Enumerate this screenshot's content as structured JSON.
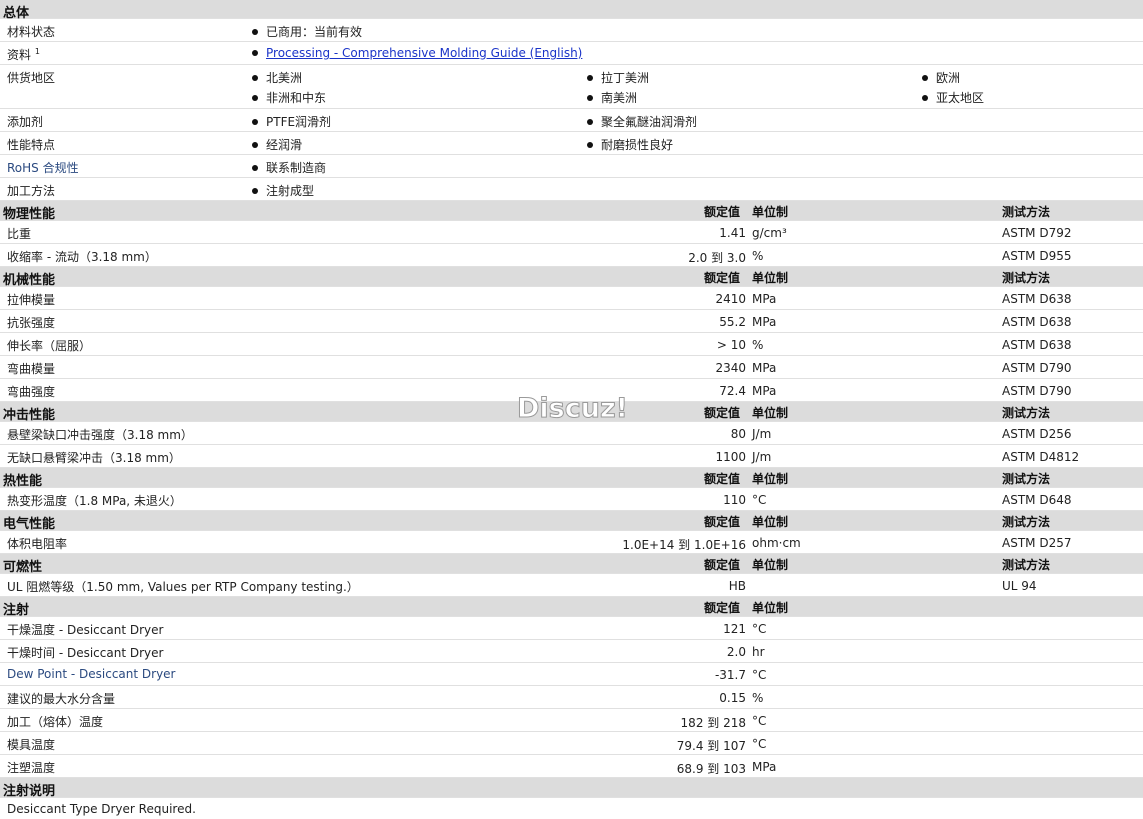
{
  "general": {
    "title": "总体",
    "material_status_label": "材料状态",
    "material_status_value": "已商用：当前有效",
    "docs_label": "资料",
    "docs_sup": "1",
    "docs_link": "Processing - Comprehensive Molding Guide (English)",
    "region_label": "供货地区",
    "regions": [
      "北美洲",
      "拉丁美洲",
      "欧洲",
      "非洲和中东",
      "南美洲",
      "亚太地区"
    ],
    "additive_label": "添加剂",
    "additives": [
      "PTFE润滑剂",
      "聚全氟醚油润滑剂"
    ],
    "feature_label": "性能特点",
    "features": [
      "经润滑",
      "耐磨损性良好"
    ],
    "rohs_label": "RoHS 合规性",
    "rohs_value": "联系制造商",
    "process_label": "加工方法",
    "process_value": "注射成型"
  },
  "headers": {
    "value": "额定值",
    "unit": "单位制",
    "method": "测试方法"
  },
  "physical": {
    "title": "物理性能",
    "rows": [
      {
        "label": "比重",
        "value": "1.41",
        "unit": "g/cm³",
        "method": "ASTM D792"
      },
      {
        "label": "收缩率 - 流动（3.18 mm）",
        "value": "2.0 到  3.0",
        "unit": "%",
        "method": "ASTM D955"
      }
    ]
  },
  "mechanical": {
    "title": "机械性能",
    "rows": [
      {
        "label": "拉伸模量",
        "value": "2410",
        "unit": "MPa",
        "method": "ASTM D638"
      },
      {
        "label": "抗张强度",
        "value": "55.2",
        "unit": "MPa",
        "method": "ASTM D638"
      },
      {
        "label": "伸长率（屈服）",
        "value": "> 10",
        "unit": "%",
        "method": "ASTM D638"
      },
      {
        "label": "弯曲模量",
        "value": "2340",
        "unit": "MPa",
        "method": "ASTM D790"
      },
      {
        "label": "弯曲强度",
        "value": "72.4",
        "unit": "MPa",
        "method": "ASTM D790"
      }
    ]
  },
  "impact": {
    "title": "冲击性能",
    "rows": [
      {
        "label": "悬壁梁缺口冲击强度（3.18 mm）",
        "value": "80",
        "unit": "J/m",
        "method": "ASTM D256"
      },
      {
        "label": "无缺口悬臂梁冲击（3.18 mm）",
        "value": "1100",
        "unit": "J/m",
        "method": "ASTM D4812"
      }
    ]
  },
  "thermal": {
    "title": "热性能",
    "rows": [
      {
        "label": "热变形温度（1.8 MPa, 未退火）",
        "value": "110",
        "unit": "°C",
        "method": "ASTM D648"
      }
    ]
  },
  "electrical": {
    "title": "电气性能",
    "rows": [
      {
        "label": "体积电阻率",
        "value": "1.0E+14 到  1.0E+16",
        "unit": "ohm·cm",
        "method": "ASTM D257"
      }
    ]
  },
  "flammability": {
    "title": "可燃性",
    "rows": [
      {
        "label": "UL 阻燃等级（1.50 mm, Values per RTP Company testing.）",
        "value": "HB",
        "unit": "",
        "method": "UL 94"
      }
    ]
  },
  "injection": {
    "title": "注射",
    "rows": [
      {
        "label": "干燥温度 - Desiccant Dryer",
        "value": "121",
        "unit": "°C"
      },
      {
        "label": "干燥时间 - Desiccant Dryer",
        "value": "2.0",
        "unit": "hr"
      },
      {
        "label": "Dew Point - Desiccant Dryer",
        "value": "-31.7",
        "unit": "°C"
      },
      {
        "label": "建议的最大水分含量",
        "value": "0.15",
        "unit": "%"
      },
      {
        "label": "加工（熔体）温度",
        "value": "182 到  218",
        "unit": "°C"
      },
      {
        "label": "模具温度",
        "value": "79.4 到  107",
        "unit": "°C"
      },
      {
        "label": "注塑温度",
        "value": "68.9 到  103",
        "unit": "MPa"
      }
    ]
  },
  "injection_notes": {
    "title": "注射说明",
    "text": "Desiccant Type Dryer Required."
  },
  "watermark": "Discuz!"
}
